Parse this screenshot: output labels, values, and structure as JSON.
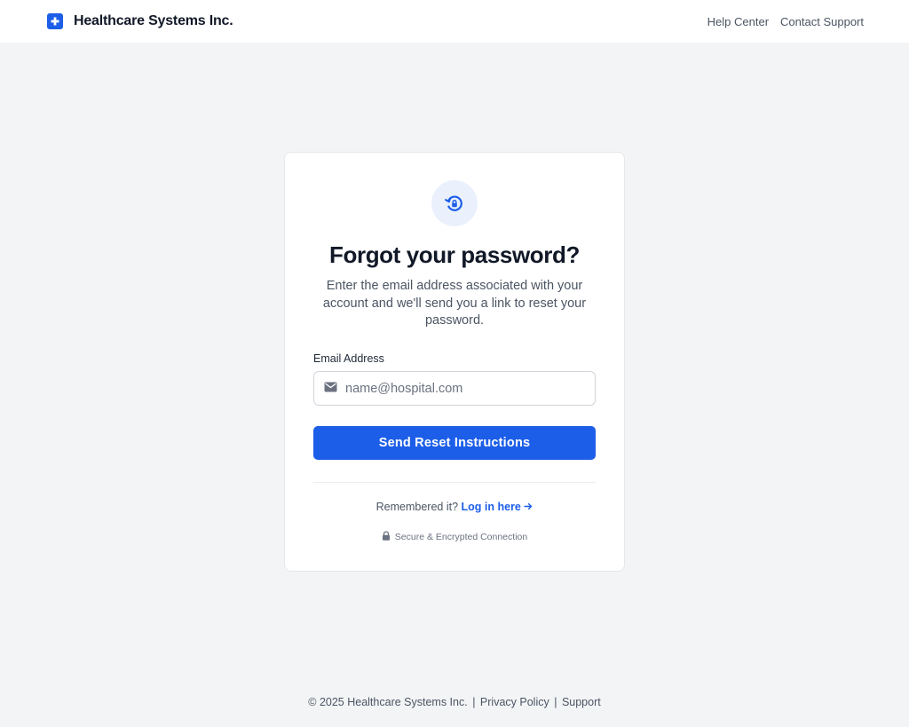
{
  "header": {
    "brand_name": "Healthcare Systems Inc.",
    "logo_icon": "medical-cross-icon",
    "nav": [
      "Help Center",
      "Contact Support"
    ]
  },
  "card": {
    "icon": "lock-reset-icon",
    "title": "Forgot your password?",
    "description": "Enter the email address associated with your account and we'll send you a link to reset your password.",
    "email_label": "Email Address",
    "email_placeholder": "name@hospital.com",
    "email_icon": "envelope-icon",
    "submit_label": "Send Reset Instructions",
    "remember_text": "Remembered it?",
    "login_link": "Log in here",
    "login_link_icon": "arrow-right-icon",
    "secure_text": "Secure & Encrypted Connection",
    "secure_icon": "lock-icon"
  },
  "footer": {
    "copyright": "© 2025 Healthcare Systems Inc.",
    "separator": "|",
    "privacy": "Privacy Policy",
    "support": "Support"
  },
  "colors": {
    "accent": "#1d5ee8",
    "background": "#f3f4f6",
    "card": "#ffffff",
    "icon_circle": "#eaf1fd"
  }
}
